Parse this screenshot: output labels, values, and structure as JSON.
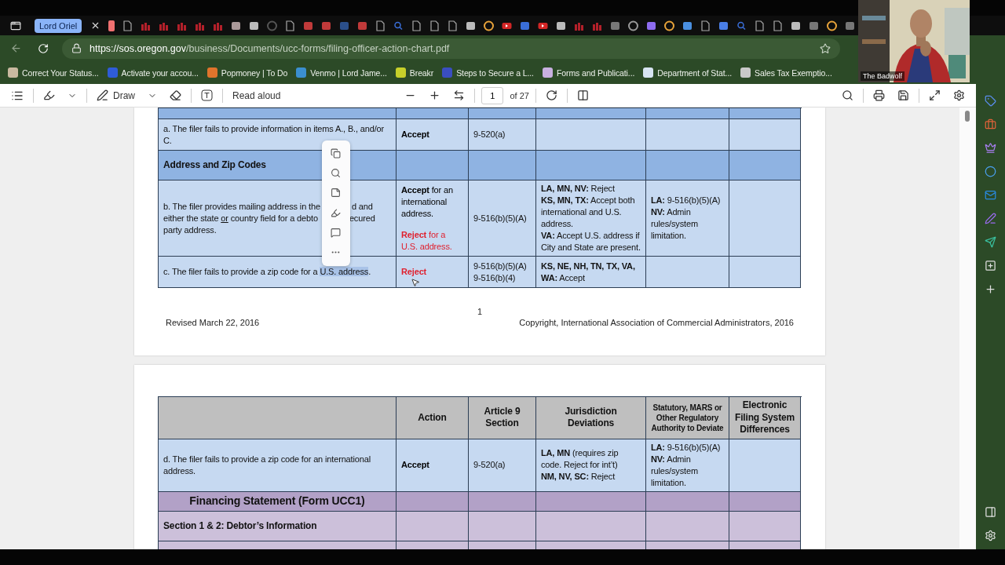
{
  "browser": {
    "tab_group": "Lord Oriel",
    "url_host": "https://sos.oregon.gov",
    "url_path": "/business/Documents/ucc-forms/filing-officer-action-chart.pdf",
    "bookmarks": [
      "Correct Your Status...",
      "Activate your accou...",
      "Popmoney | To Do",
      "Venmo | Lord Jame...",
      "Breakr",
      "Steps to Secure a L...",
      "Forms and Publicati...",
      "Department of Stat...",
      "Sales Tax Exemptio..."
    ]
  },
  "webcam": {
    "name": "The Badwolf"
  },
  "pdf_toolbar": {
    "draw": "Draw",
    "read_aloud": "Read aloud",
    "page": "1",
    "page_count": "of 27"
  },
  "page_1": {
    "rows": [
      {
        "kind": "stub",
        "color": "#8fb3e2"
      },
      {
        "kind": "item",
        "color": "#c6d9f1",
        "item": [
          {
            "text": "a.  The filer fails to provide information in items A., B., and/or C."
          }
        ],
        "action": [
          {
            "text": "Accept",
            "bold": true,
            "color": "#000000"
          }
        ],
        "article": [
          "9-520(a)"
        ],
        "jurisdiction": [],
        "statutory": []
      },
      {
        "kind": "section",
        "color": "#8fb3e2",
        "title": "Address and Zip Codes"
      },
      {
        "kind": "item",
        "color": "#c6d9f1",
        "popup": true,
        "item": [
          {
            "text": "b.  The filer provides mailing address in the"
          },
          {
            "text": "d and",
            "gap_before": true
          },
          {
            "text": "either the state ",
            "break_before": true
          },
          {
            "text": "or",
            "underlined": true
          },
          {
            "text": " country field for a debto"
          },
          {
            "text": "ecured",
            "gap_before": true
          },
          {
            "text": "party address.",
            "break_before": true
          }
        ],
        "action": [
          {
            "text": "**Accept** for an international address.",
            "bold": false,
            "color": "#000000"
          },
          {
            "text": "**Reject** for a U.S. address.",
            "bold": false,
            "color": "#e0202e"
          }
        ],
        "article": [
          "9-516(b)(5)(A)"
        ],
        "jurisdiction": [
          "**LA, MN, NV:** Reject",
          "**KS, MN, TX:** Accept both international and U.S. address.",
          "**VA:** Accept U.S. address if City and State are present."
        ],
        "statutory": [
          "**LA:** 9-516(b)(5)(A)",
          "**NV:** Admin rules/system limitation."
        ]
      },
      {
        "kind": "item",
        "color": "#c6d9f1",
        "pointer": true,
        "item": [
          {
            "text": "c.  The filer fails to provide a zip code for a ",
            "selected": false
          },
          {
            "text": "U.S. address",
            "selected": true
          },
          {
            "text": ".",
            "selected": false
          }
        ],
        "action": [
          {
            "text": "Reject",
            "bold": true,
            "color": "#e0202e"
          }
        ],
        "article": [
          "9-516(b)(5)(A)",
          "9-516(b)(4)"
        ],
        "jurisdiction": [
          "**KS, NE, NH, TN, TX, VA, WA:** Accept"
        ],
        "statutory": []
      }
    ],
    "footer": {
      "page_number": "1",
      "revised": "Revised March 22, 2016",
      "copyright": "Copyright, International Association of Commercial Administrators, 2016"
    }
  },
  "page_2": {
    "columns": [
      "Action",
      "Article 9 Section",
      "Jurisdiction Deviations",
      "Statutory, MARS or Other Regulatory Authority to Deviate",
      "Electronic Filing System Differences"
    ],
    "rows": [
      {
        "kind": "item",
        "color": "#c6d9f1",
        "item": [
          {
            "text": "d.  The filer fails to provide a zip code for an international address."
          }
        ],
        "action": [
          {
            "text": "Accept",
            "bold": true,
            "color": "#000000"
          }
        ],
        "article": [
          "9-520(a)"
        ],
        "jurisdiction": [
          "**LA, MN** (requires zip code.  Reject for int’t)",
          "**NM, NV, SC:** Reject"
        ],
        "statutory": [
          "**LA:** 9-516(b)(5)(A)",
          "**NV:** Admin rules/system limitation."
        ]
      },
      {
        "kind": "title",
        "color": "#b2a1c7",
        "title": "Financing Statement (Form UCC1)"
      },
      {
        "kind": "section",
        "color": "#ccc0da",
        "title": "Section 1 & 2:  Debtor’s Information"
      },
      {
        "kind": "stub",
        "color": "#ccc0da"
      }
    ]
  }
}
